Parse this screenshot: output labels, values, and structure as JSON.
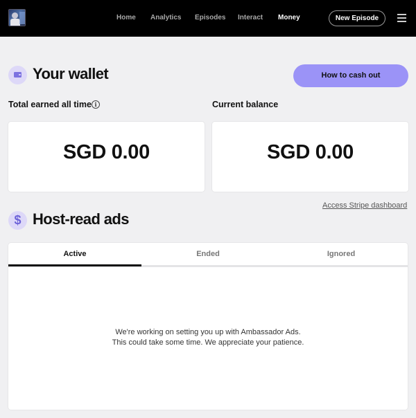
{
  "topnav": {
    "logo_icon": "podcast-cover-art",
    "items": [
      {
        "label": "Home",
        "active": false
      },
      {
        "label": "Analytics",
        "active": false
      },
      {
        "label": "Episodes",
        "active": false
      },
      {
        "label": "Interact",
        "active": false
      },
      {
        "label": "Money",
        "active": true
      }
    ],
    "new_episode_label": "New Episode",
    "menu_icon": "hamburger-menu-icon"
  },
  "wallet": {
    "icon": "wallet-icon",
    "title": "Your wallet",
    "cash_out_label": "How to cash out",
    "total_earned_label": "Total earned all time",
    "info_icon": "info-icon",
    "current_balance_label": "Current balance",
    "total_earned_amount": "SGD 0.00",
    "current_balance_amount": "SGD 0.00"
  },
  "stripe_link": "Access Stripe dashboard",
  "ads": {
    "icon": "dollar-icon",
    "title": "Host-read ads",
    "tabs": [
      {
        "label": "Active",
        "selected": true
      },
      {
        "label": "Ended",
        "selected": false
      },
      {
        "label": "Ignored",
        "selected": false
      }
    ],
    "empty_line1": "We're working on setting you up with Ambassador Ads.",
    "empty_line2": "This could take some time. We appreciate your patience."
  },
  "colors": {
    "topbar": "#000000",
    "accent": "#9b93f7",
    "icon_bg": "#ddd8f8",
    "page_bg": "#f0f0f2"
  }
}
